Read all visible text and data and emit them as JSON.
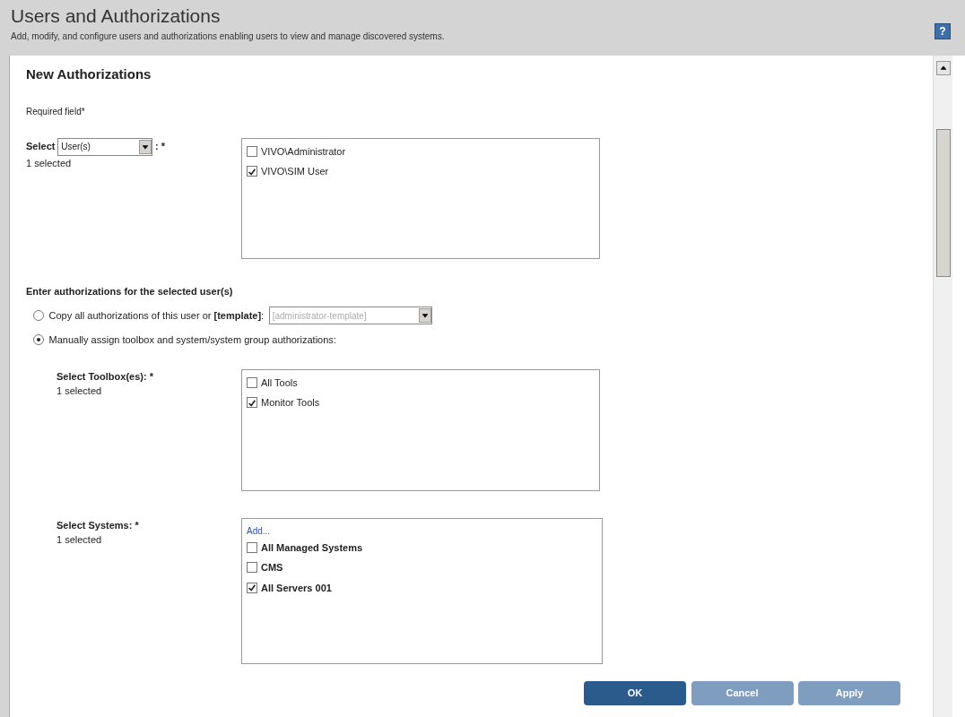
{
  "header": {
    "title": "Users and Authorizations",
    "subtitle": "Add, modify, and configure users and authorizations enabling users to view and manage discovered systems.",
    "help": "?"
  },
  "panel": {
    "title": "New Authorizations",
    "required_note": "Required field*"
  },
  "user_select": {
    "label": "Select",
    "dropdown": "User(s)",
    "suffix": ": *",
    "count": "1 selected",
    "items": [
      {
        "label": "VIVO\\Administrator",
        "checked": false
      },
      {
        "label": "VIVO\\SIM User",
        "checked": true
      }
    ]
  },
  "authorizations": {
    "heading": "Enter authorizations for the selected user(s)",
    "options": [
      {
        "label": "Copy all authorizations of this user or **[template]**:",
        "selected": false,
        "template": "[administrator-template]",
        "template_disabled": true
      },
      {
        "label": "Manually assign toolbox and system/system group authorizations:",
        "selected": true
      }
    ]
  },
  "toolboxes": {
    "label": "Select Toolbox(es): *",
    "count": "1 selected",
    "items": [
      {
        "label": "All Tools",
        "checked": false
      },
      {
        "label": "Monitor Tools",
        "checked": true
      }
    ]
  },
  "systems": {
    "label": "Select Systems: *",
    "count": "1 selected",
    "add_link": "Add...",
    "items": [
      {
        "label": "All Managed Systems",
        "checked": false
      },
      {
        "label": "CMS",
        "checked": false
      },
      {
        "label": "All Servers 001",
        "checked": true
      }
    ]
  },
  "buttons": [
    {
      "label": "OK",
      "kind": "primary"
    },
    {
      "label": "Cancel",
      "kind": "secondary"
    },
    {
      "label": "Apply",
      "kind": "secondary"
    }
  ]
}
